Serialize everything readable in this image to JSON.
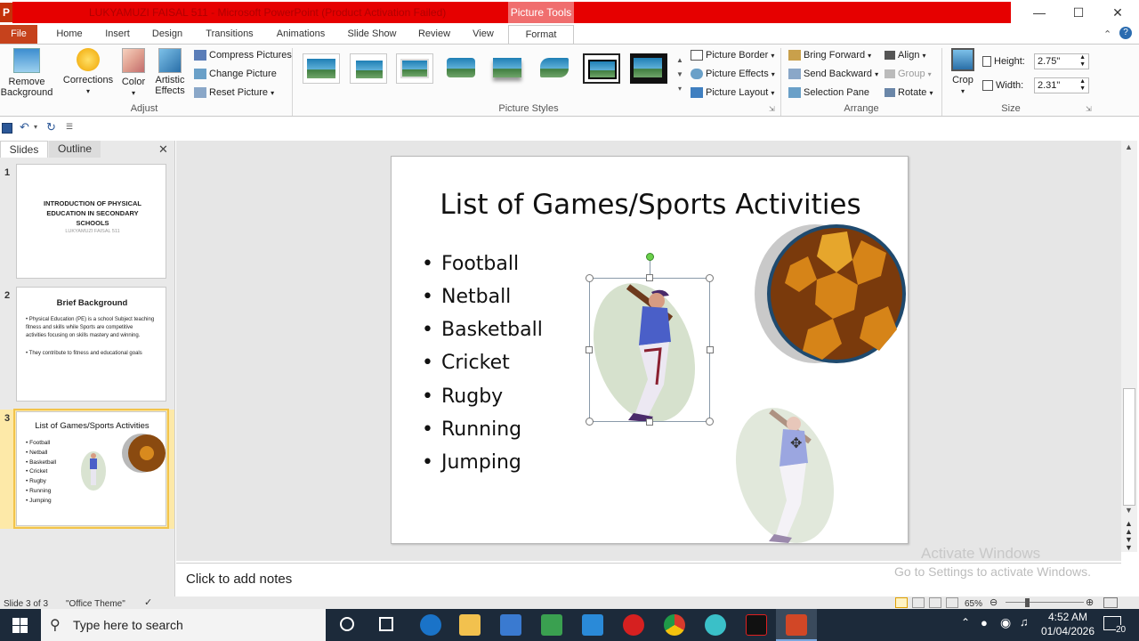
{
  "window": {
    "title": "LUKYAMUZI FAISAL 511 - Microsoft PowerPoint (Product Activation Failed)",
    "context_tab": "Picture Tools",
    "app_letter": "P"
  },
  "tabs": [
    "File",
    "Home",
    "Insert",
    "Design",
    "Transitions",
    "Animations",
    "Slide Show",
    "Review",
    "View",
    "Format"
  ],
  "ribbon": {
    "remove_background": "Remove Background",
    "corrections": "Corrections",
    "color": "Color",
    "artistic_effects": "Artistic Effects",
    "compress_pictures": "Compress Pictures",
    "change_picture": "Change Picture",
    "reset_picture": "Reset Picture",
    "group_adjust": "Adjust",
    "group_picture_styles": "Picture Styles",
    "picture_border": "Picture Border",
    "picture_effects": "Picture Effects",
    "picture_layout": "Picture Layout",
    "bring_forward": "Bring Forward",
    "send_backward": "Send Backward",
    "selection_pane": "Selection Pane",
    "align": "Align",
    "group": "Group",
    "rotate": "Rotate",
    "group_arrange": "Arrange",
    "crop": "Crop",
    "height_label": "Height:",
    "height_value": "2.75\"",
    "width_label": "Width:",
    "width_value": "2.31\"",
    "group_size": "Size"
  },
  "panel": {
    "tab_slides": "Slides",
    "tab_outline": "Outline",
    "slides": [
      {
        "num": "1",
        "title": "INTRODUCTION OF PHYSICAL EDUCATION IN SECONDARY SCHOOLS",
        "subtitle": "LUKYAMUZI FAISAL 511"
      },
      {
        "num": "2",
        "title": "Brief Background",
        "bullets": [
          "Physical Education (PE) is a school Subject teaching fitness and skills while Sports are competitive activities focusing on skills mastery and winning.",
          "They contribute to fitness and educational goals"
        ]
      },
      {
        "num": "3",
        "title": "List of Games/Sports Activities",
        "bullets": [
          "Football",
          "Netball",
          "Basketball",
          "Cricket",
          "Rugby",
          "Running",
          "Jumping"
        ]
      }
    ]
  },
  "slide": {
    "title": "List of Games/Sports Activities",
    "bullets": [
      "Football",
      "Netball",
      "Basketball",
      "Cricket",
      "Rugby",
      "Running",
      "Jumping"
    ]
  },
  "notes": {
    "placeholder": "Click to add notes"
  },
  "status": {
    "slide": "Slide 3 of 3",
    "theme": "\"Office Theme\"",
    "zoom": "65%"
  },
  "watermark": {
    "line1": "Activate Windows",
    "line2": "Go to Settings to activate Windows."
  },
  "taskbar": {
    "search_placeholder": "Type here to search",
    "time": "4:52 AM",
    "date": "01/04/2026",
    "notifications": "20"
  },
  "colors": {
    "accent_file": "#c6421c",
    "title_red": "#e60000",
    "selection_yellow": "#f2c44b"
  }
}
